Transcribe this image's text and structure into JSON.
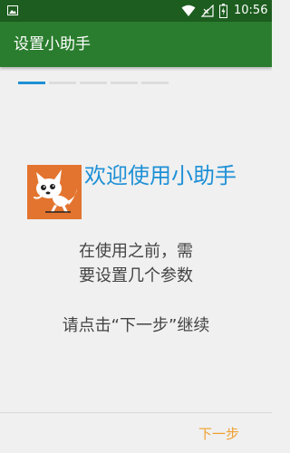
{
  "status_bar": {
    "time": "10:56",
    "background": "#1d5d1f",
    "icons": [
      "thumbnail-icon",
      "wifi-icon",
      "no-signal-icon",
      "battery-charging-icon"
    ]
  },
  "app_bar": {
    "title": "设置小助手",
    "background": "#2a7d2e"
  },
  "steps": {
    "count": 5,
    "active_index": 0,
    "active_color": "#1e90d6",
    "inactive_color": "#dcdcdc"
  },
  "welcome": {
    "logo_icon": "fox-cartoon-logo",
    "logo_color": "#e3742f",
    "title": "欢迎使用小助手",
    "title_color": "#1e90d6",
    "description_line1": "在使用之前，需",
    "description_line2": "要设置几个参数",
    "instruction": "请点击“下一步”继续"
  },
  "footer": {
    "next_label": "下一步",
    "next_color": "#f0a030"
  }
}
